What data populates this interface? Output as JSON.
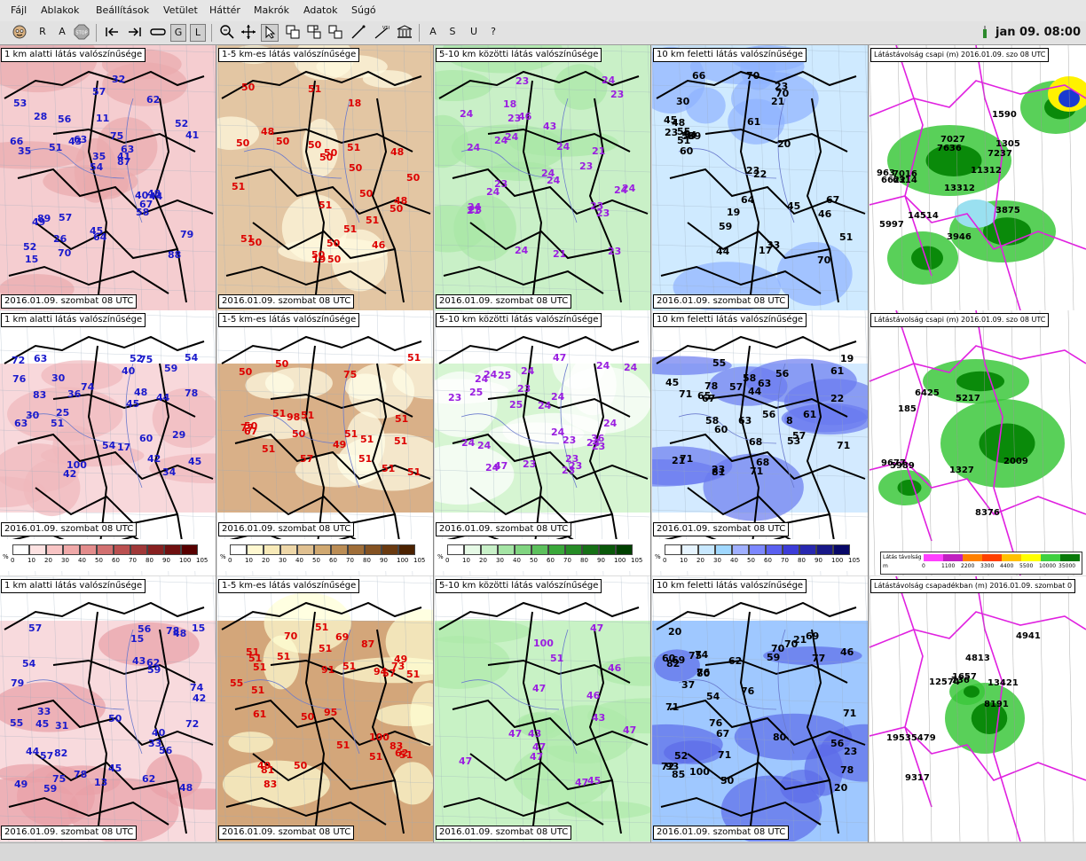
{
  "menu": [
    "Fájl",
    "Ablakok",
    "Beállítások",
    "Vetület",
    "Háttér",
    "Makrók",
    "Adatok",
    "Súgó"
  ],
  "toolbar": {
    "r": "R",
    "a": "A",
    "g": "G",
    "l": "L",
    "a2": "A",
    "s": "S",
    "u": "U",
    "help": "?"
  },
  "clock": "jan 09. 08:00",
  "date_label": "2016.01.09. szombat 08 UTC",
  "columns": [
    {
      "title": "1 km alatti látás valószínűsége",
      "color": "#1a1acc"
    },
    {
      "title": "1-5 km-es látás valószínűsége",
      "color": "#dd0000"
    },
    {
      "title": "5-10 km közötti látás valószínűsége",
      "color": "#9a1ee0"
    },
    {
      "title": "10 km feletti látás valószínűsége",
      "color": "#000000"
    }
  ],
  "radar_titles": [
    "Látástávolság csapi (m) 2016.01.09. szo 08 UTC",
    "Látástávolság csapi (m) 2016.01.09. szo 08 UTC",
    "Látástávolság csapadékban (m) 2016.01.09. szombat 0"
  ],
  "legend_ticks": [
    "0",
    "10",
    "20",
    "30",
    "40",
    "50",
    "60",
    "70",
    "80",
    "90",
    "100",
    "105"
  ],
  "legend_pct": "%",
  "legend_colors": {
    "red": [
      "#ffffff",
      "#fde2e2",
      "#f8c4c4",
      "#f0a9a9",
      "#e38c8c",
      "#d27070",
      "#bb5050",
      "#a03838",
      "#882020",
      "#701010",
      "#580000"
    ],
    "brown": [
      "#ffffff",
      "#fff8d0",
      "#f8eab8",
      "#eed7a8",
      "#e0c090",
      "#d0a870",
      "#bb8d55",
      "#a06e38",
      "#845222",
      "#6a3a10",
      "#4c2200"
    ],
    "green": [
      "#ffffff",
      "#e6fae6",
      "#c8f0c8",
      "#a4e4a4",
      "#80d480",
      "#5cc05c",
      "#3aa83a",
      "#268c26",
      "#167016",
      "#0a580a",
      "#004000"
    ],
    "blue": [
      "#ffffff",
      "#e6f4ff",
      "#c8e8ff",
      "#a0d8ff",
      "#a0b0ff",
      "#7c88ff",
      "#5a60f0",
      "#3c3cd8",
      "#2828b0",
      "#181888",
      "#080868"
    ]
  },
  "radar_legend": {
    "label": "Látás távolság",
    "unit": "m",
    "ticks": [
      "0",
      "1100",
      "2200",
      "3300",
      "4400",
      "5500",
      "10000",
      "35000"
    ]
  },
  "panels": [
    [
      {
        "vals": [
          "75",
          "89",
          "63",
          "52",
          "26",
          "11",
          "63",
          "44",
          "28",
          "57",
          "35",
          "40",
          "41",
          "54",
          "45",
          "35",
          "56",
          "62",
          "57",
          "88",
          "79",
          "48",
          "32",
          "43",
          "51",
          "58",
          "70",
          "66",
          "41",
          "15",
          "64",
          "87",
          "49",
          "52",
          "53",
          "67"
        ]
      },
      {
        "vals": [
          "50",
          "50",
          "51",
          "50",
          "48",
          "51",
          "50",
          "50",
          "50",
          "50",
          "50",
          "48",
          "50",
          "48",
          "51",
          "46",
          "50",
          "51",
          "51",
          "50",
          "51",
          "51",
          "50",
          "50",
          "50",
          "19",
          "18"
        ]
      },
      {
        "vals": [
          "23",
          "46",
          "23",
          "21",
          "24",
          "43",
          "23",
          "23",
          "24",
          "23",
          "24",
          "21",
          "24",
          "23",
          "21",
          "24",
          "18",
          "24",
          "23",
          "23",
          "24",
          "24",
          "24",
          "24",
          "24",
          "23",
          "24",
          "24"
        ]
      },
      {
        "vals": [
          "70",
          "70",
          "55",
          "64",
          "51",
          "66",
          "70",
          "46",
          "33",
          "23",
          "23",
          "20",
          "44",
          "21",
          "45",
          "45",
          "54",
          "48",
          "22",
          "17",
          "51",
          "30",
          "59",
          "58",
          "60",
          "59",
          "23",
          "67",
          "19",
          "61"
        ]
      }
    ],
    [
      {
        "vals": [
          "45",
          "59",
          "63",
          "42",
          "52",
          "76",
          "42",
          "72",
          "51",
          "40",
          "25",
          "30",
          "63",
          "60",
          "78",
          "29",
          "75",
          "83",
          "54",
          "17",
          "45",
          "30",
          "48",
          "44",
          "74",
          "100",
          "54",
          "36",
          "34"
        ]
      },
      {
        "vals": [
          "50",
          "98",
          "77",
          "51",
          "51",
          "75",
          "51",
          "51",
          "50",
          "51",
          "51",
          "51",
          "50",
          "49",
          "51",
          "57",
          "51",
          "51",
          "67",
          "51",
          "50"
        ]
      },
      {
        "vals": [
          "23",
          "47",
          "24",
          "25",
          "23",
          "24",
          "24",
          "24",
          "24",
          "24",
          "23",
          "24",
          "24",
          "23",
          "36",
          "24",
          "47",
          "23",
          "23",
          "24",
          "23",
          "24",
          "24",
          "25",
          "25",
          "23",
          "24"
        ]
      },
      {
        "vals": [
          "44",
          "71",
          "71",
          "60",
          "56",
          "55",
          "61",
          "58",
          "8",
          "78",
          "57",
          "56",
          "45",
          "23",
          "58",
          "68",
          "81",
          "71",
          "61",
          "57",
          "21",
          "53",
          "22",
          "63",
          "71",
          "67",
          "65",
          "68",
          "19",
          "63"
        ]
      }
    ],
    [
      {
        "vals": [
          "15",
          "13",
          "15",
          "55",
          "40",
          "59",
          "75",
          "54",
          "33",
          "79",
          "56",
          "48",
          "43",
          "74",
          "62",
          "45",
          "31",
          "42",
          "72",
          "78",
          "49",
          "82",
          "57",
          "57",
          "33",
          "78",
          "59",
          "56",
          "48",
          "44",
          "62",
          "45",
          "50"
        ]
      },
      {
        "vals": [
          "62",
          "51",
          "91",
          "83",
          "51",
          "100",
          "87",
          "51",
          "51",
          "94",
          "49",
          "51",
          "50",
          "50",
          "51",
          "73",
          "51",
          "49",
          "51",
          "69",
          "51",
          "57",
          "55",
          "61",
          "51",
          "51",
          "51",
          "70",
          "81",
          "95",
          "83"
        ]
      },
      {
        "vals": [
          "47",
          "51",
          "47",
          "100",
          "47",
          "47",
          "47",
          "47",
          "46",
          "43",
          "46",
          "43",
          "45",
          "47",
          "47"
        ]
      },
      {
        "vals": [
          "93",
          "71",
          "70",
          "76",
          "50",
          "80",
          "100",
          "76",
          "60",
          "20",
          "71",
          "62",
          "54",
          "67",
          "80",
          "37",
          "21",
          "85",
          "46",
          "59",
          "69",
          "75",
          "76",
          "20",
          "23",
          "56",
          "71",
          "77",
          "52",
          "70",
          "78",
          "72",
          "74",
          "69",
          "82"
        ]
      }
    ]
  ],
  "radar": [
    {
      "vals": [
        "1305",
        "11312",
        "3946",
        "6314",
        "7027",
        "3875",
        "14514",
        "7016",
        "1590",
        "7636",
        "963",
        "7237",
        "6622",
        "13312",
        "5997"
      ]
    },
    {
      "vals": [
        "6425",
        "1327",
        "5217",
        "8376",
        "5989",
        "2009",
        "9677",
        "185"
      ]
    },
    {
      "vals": [
        "4941",
        "4813",
        "1657",
        "9317",
        "8191",
        "13421",
        "12574",
        "736",
        "19535479"
      ]
    }
  ]
}
